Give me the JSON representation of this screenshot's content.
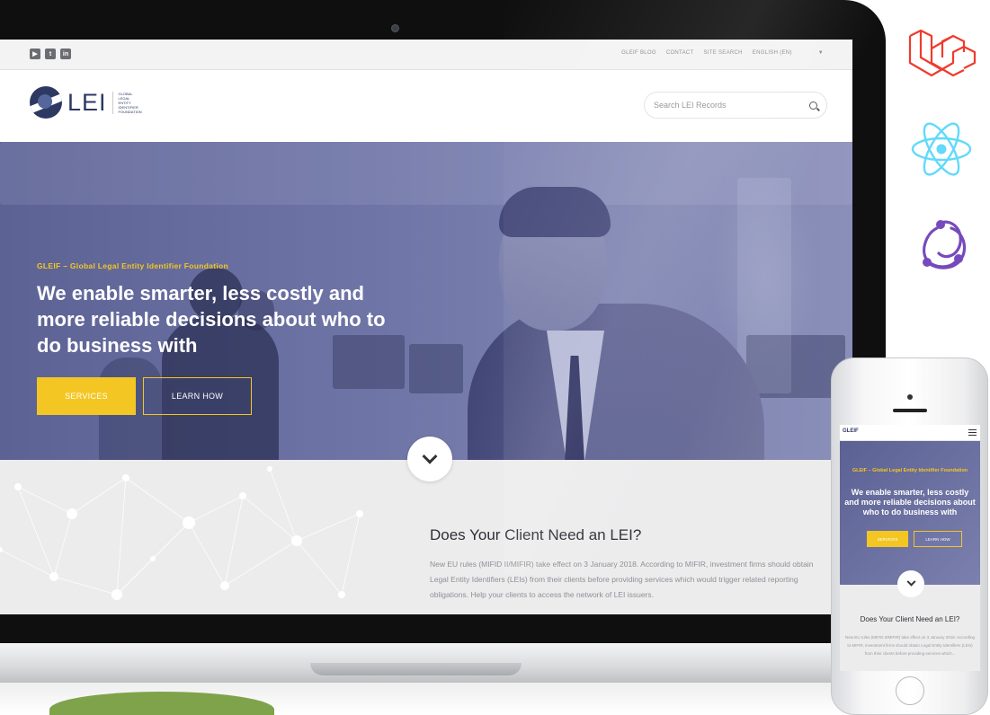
{
  "topbar": {
    "social_icons": [
      "youtube-icon",
      "twitter-icon",
      "linkedin-icon"
    ],
    "links": [
      "GLEIF BLOG",
      "CONTACT",
      "SITE SEARCH",
      "ENGLISH (EN)"
    ]
  },
  "header": {
    "logo_text": "LEI",
    "logo_sub": "Global Legal Entity Identifier Foundation",
    "search_placeholder": "Search LEI Records"
  },
  "hero": {
    "kicker": "GLEIF – Global Legal Entity Identifier Foundation",
    "title": "We enable smarter, less costly and more reliable decisions about who to do business with",
    "services_label": "SERVICES",
    "learn_label": "LEARN HOW"
  },
  "section": {
    "title": "Does Your Client Need an LEI?",
    "body": "New EU rules (MIFID II/MIFIR) take effect on 3 January 2018. According to MIFIR, investment firms should obtain Legal Entity Identifiers (LEIs) from their clients before providing services which would trigger related reporting obligations. Help your clients to access the network of LEI issuers."
  },
  "phone": {
    "logo_text": "GLEIF",
    "kicker": "GLEIF – Global Legal Entity Identifier Foundation",
    "title": "We enable smarter, less costly and more reliable decisions about who to do business with",
    "services_label": "SERVICES",
    "learn_label": "LEARN HOW",
    "section_title": "Does Your Client Need an LEI?",
    "section_body": "New EU rules (MIFID II/MIFIR) take effect on 3 January 2018. According to MIFIR, investment firms should obtain Legal Entity Identifiers (LEIs) from their clients before providing services which..."
  },
  "tech_icons": [
    "laravel-icon",
    "react-icon",
    "redux-icon"
  ],
  "colors": {
    "accent": "#f4c623",
    "brand_navy": "#2d3963",
    "hero_overlay": "#6f75a6",
    "laravel": "#ef3b2d",
    "react": "#61dafb",
    "redux": "#764abc"
  }
}
